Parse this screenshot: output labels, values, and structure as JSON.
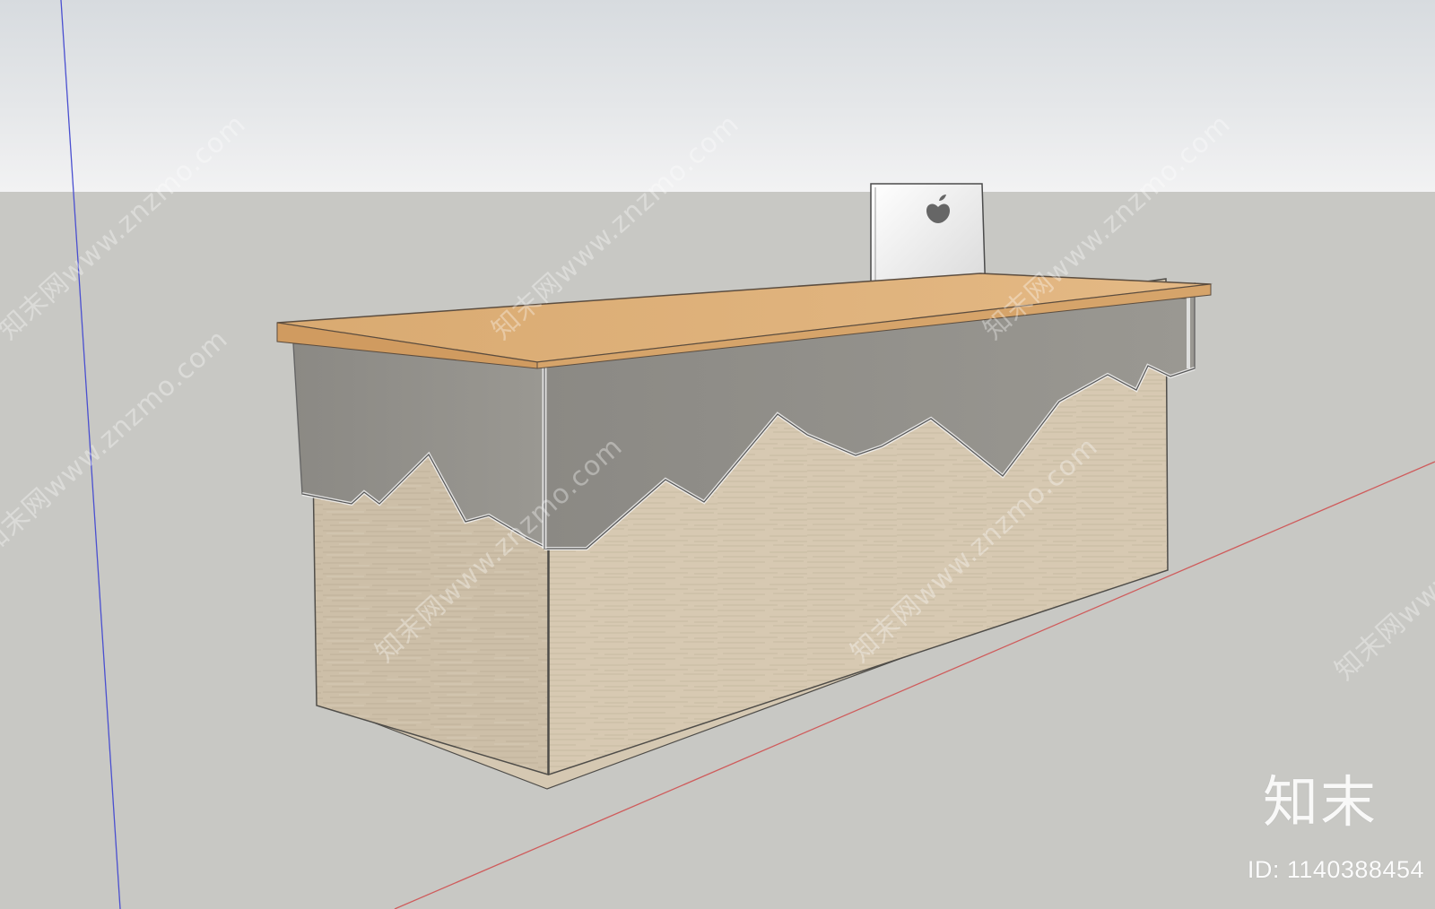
{
  "watermark": {
    "text": "知末网www.znzmo.com"
  },
  "branding": {
    "logo_text": "知末",
    "id_text": "ID: 1140388454"
  },
  "scene": {
    "sky_color": "#e3e5e7",
    "ground_color": "#c8c8c4",
    "wood_color": "#e0b37b",
    "glass_color": "#8f8d88",
    "stone_color": "#cdbfa8",
    "axis_blue": "#4a4fd0",
    "axis_red": "#cf5c5c",
    "apple_logo_icon": "apple-logo-icon"
  }
}
